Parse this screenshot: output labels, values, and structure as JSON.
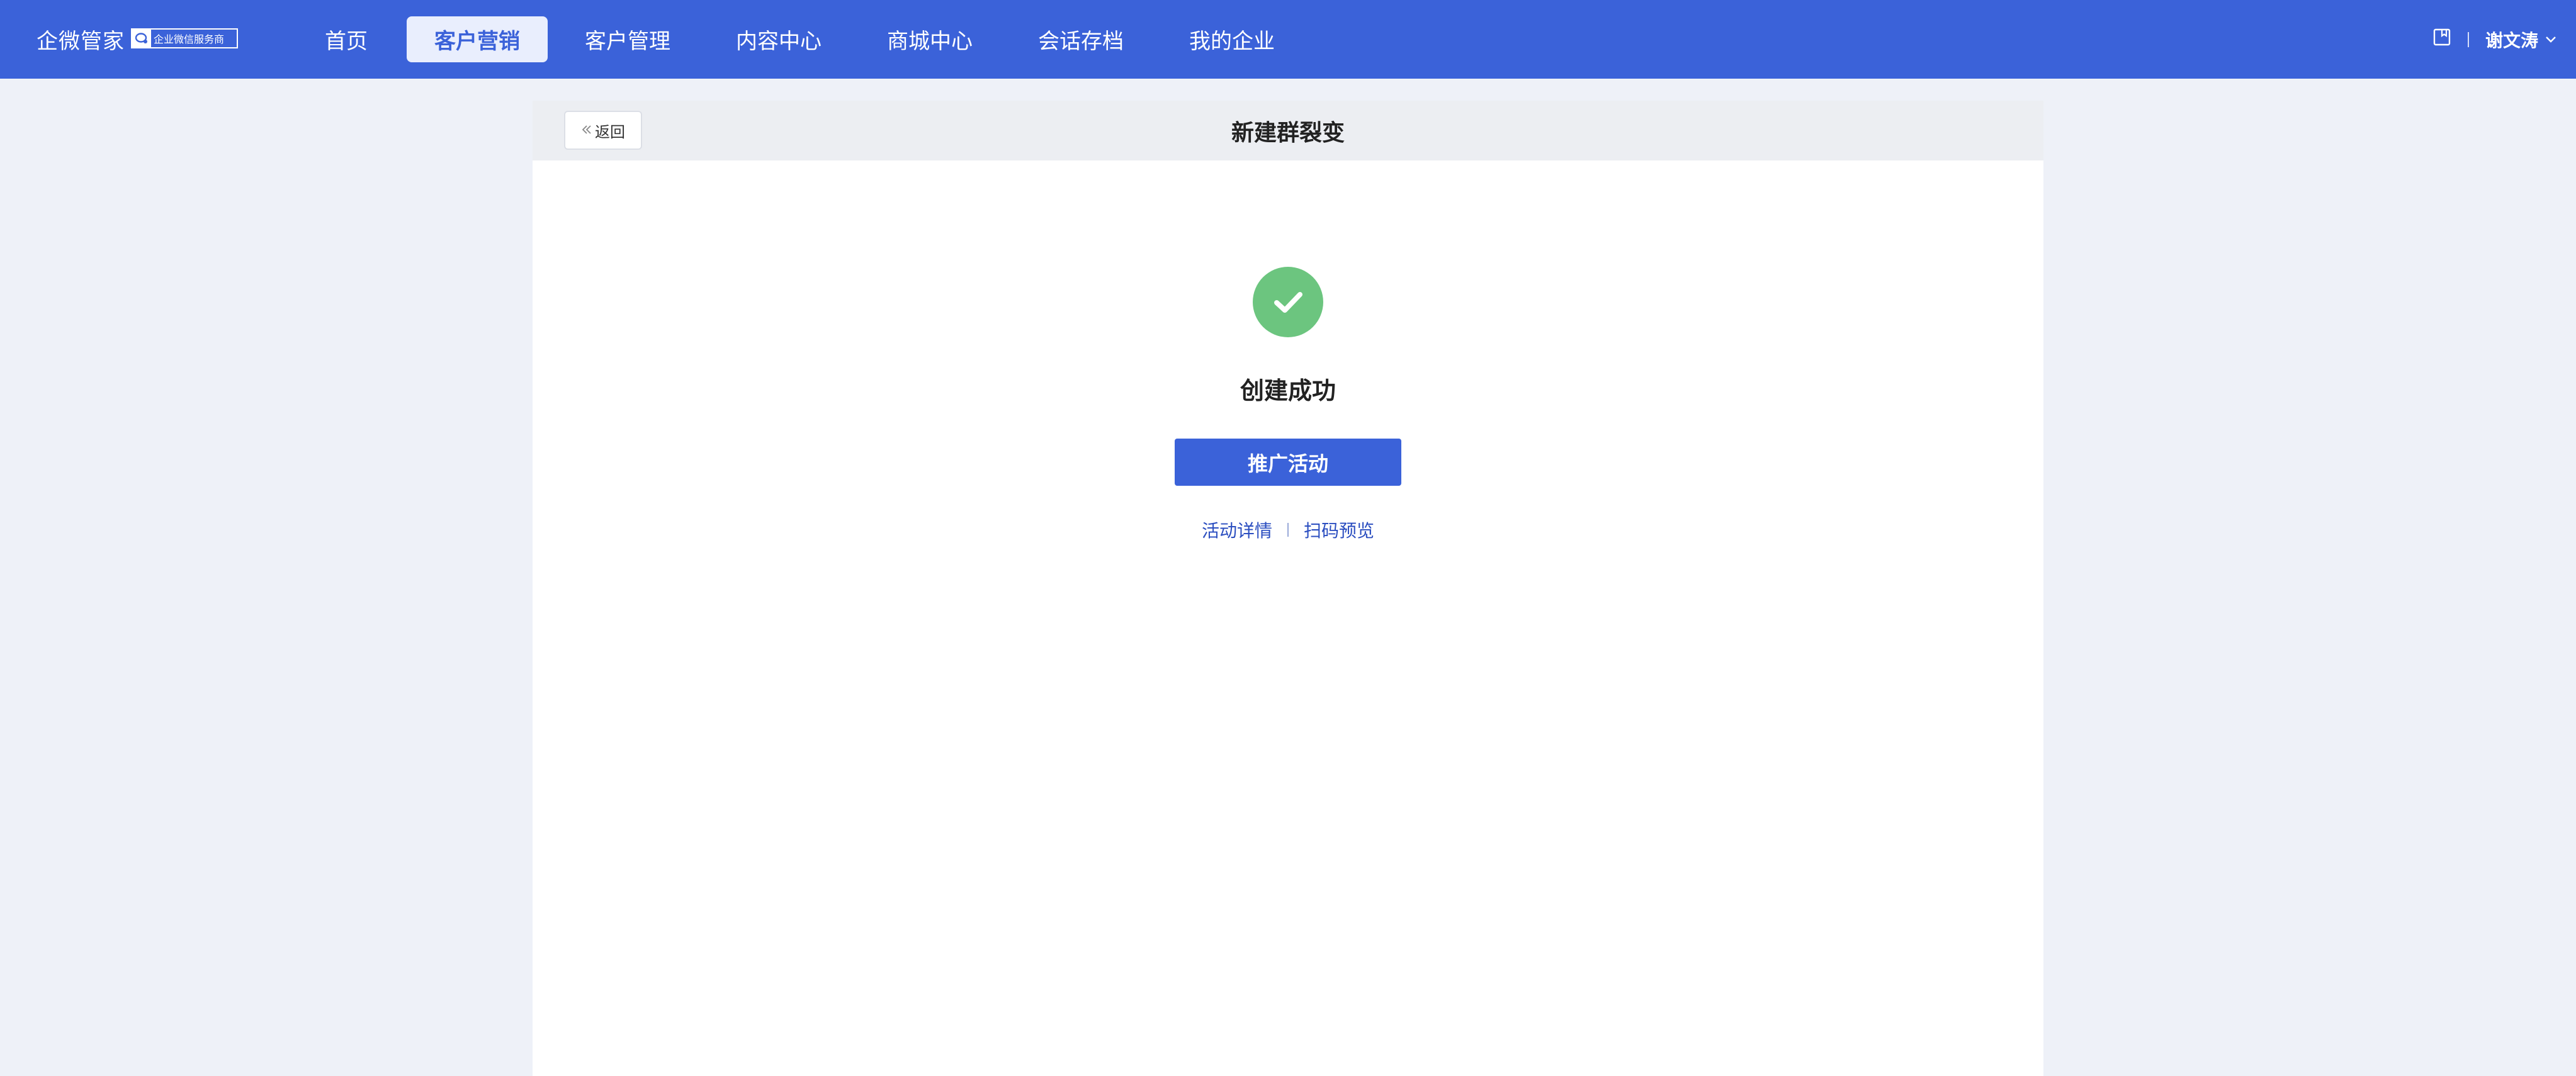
{
  "topbar": {
    "brand": "企微管家",
    "badge": "企业微信服务商",
    "nav": [
      {
        "label": "首页"
      },
      {
        "label": "客户营销",
        "active": true
      },
      {
        "label": "客户管理"
      },
      {
        "label": "内容中心"
      },
      {
        "label": "商城中心"
      },
      {
        "label": "会话存档"
      },
      {
        "label": "我的企业"
      }
    ],
    "user_name": "谢文涛"
  },
  "page": {
    "back_label": "返回",
    "title": "新建群裂变",
    "success_text": "创建成功",
    "promote_label": "推广活动",
    "link_detail": "活动详情",
    "link_preview": "扫码预览"
  },
  "colors": {
    "primary": "#3b62d9",
    "success": "#6cc57f",
    "background": "#eef1f8"
  }
}
